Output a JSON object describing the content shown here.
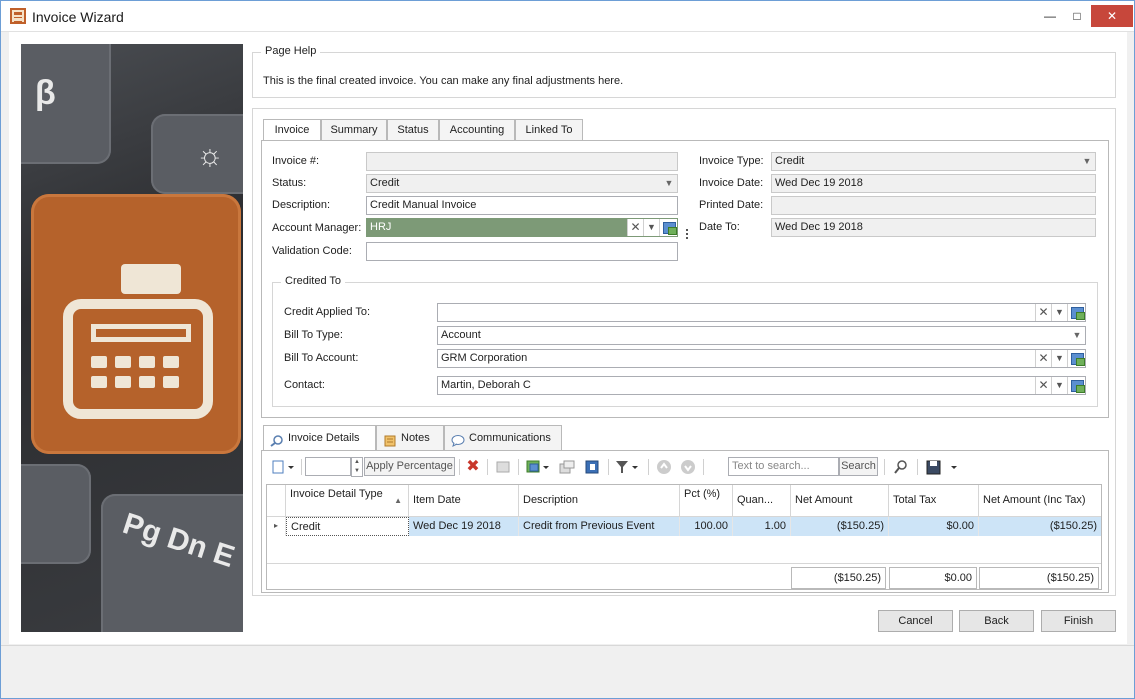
{
  "window": {
    "title": "Invoice Wizard"
  },
  "page_help": {
    "legend": "Page Help",
    "text": "This is the final created invoice.  You can make any final adjustments here."
  },
  "tabs": [
    "Invoice",
    "Summary",
    "Status",
    "Accounting",
    "Linked To"
  ],
  "invoice": {
    "invoice_number_label": "Invoice #:",
    "invoice_number_value": "",
    "status_label": "Status:",
    "status_value": "Credit",
    "description_label": "Description:",
    "description_value": "Credit Manual Invoice",
    "account_manager_label": "Account Manager:",
    "account_manager_value": "HRJ",
    "validation_code_label": "Validation Code:",
    "validation_code_value": "",
    "invoice_type_label": "Invoice Type:",
    "invoice_type_value": "Credit",
    "invoice_date_label": "Invoice Date:",
    "invoice_date_value": "Wed Dec 19 2018",
    "printed_date_label": "Printed Date:",
    "printed_date_value": "",
    "date_to_label": "Date To:",
    "date_to_value": "Wed Dec 19 2018"
  },
  "credited_to": {
    "legend": "Credited To",
    "credit_applied_to_label": "Credit Applied To:",
    "credit_applied_to_value": "",
    "bill_to_type_label": "Bill To Type:",
    "bill_to_type_value": "Account",
    "bill_to_account_label": "Bill To Account:",
    "bill_to_account_value": "GRM Corporation",
    "contact_label": "Contact:",
    "contact_value": "Martin, Deborah C"
  },
  "detail_tabs": [
    "Invoice Details",
    "Notes",
    "Communications"
  ],
  "toolbar": {
    "apply_percentage": "Apply Percentage",
    "search_placeholder": "Text to search...",
    "search_button": "Search"
  },
  "grid": {
    "columns": [
      "Invoice Detail Type",
      "Item Date",
      "Description",
      "Pct (%)",
      "Quan...",
      "Net Amount",
      "Total Tax",
      "Net Amount (Inc Tax)"
    ],
    "rows": [
      {
        "type": "Credit",
        "item_date": "Wed Dec 19 2018",
        "description": "Credit from Previous Event",
        "pct": "100.00",
        "quantity": "1.00",
        "net_amount": "($150.25)",
        "total_tax": "$0.00",
        "net_inc_tax": "($150.25)"
      }
    ],
    "totals": {
      "net_amount": "($150.25)",
      "total_tax": "$0.00",
      "net_inc_tax": "($150.25)"
    }
  },
  "buttons": {
    "cancel": "Cancel",
    "back": "Back",
    "finish": "Finish"
  },
  "colors": {
    "accent_green": "#7d9a77",
    "row_selected": "#cde4f7",
    "close_red": "#c7473b"
  }
}
